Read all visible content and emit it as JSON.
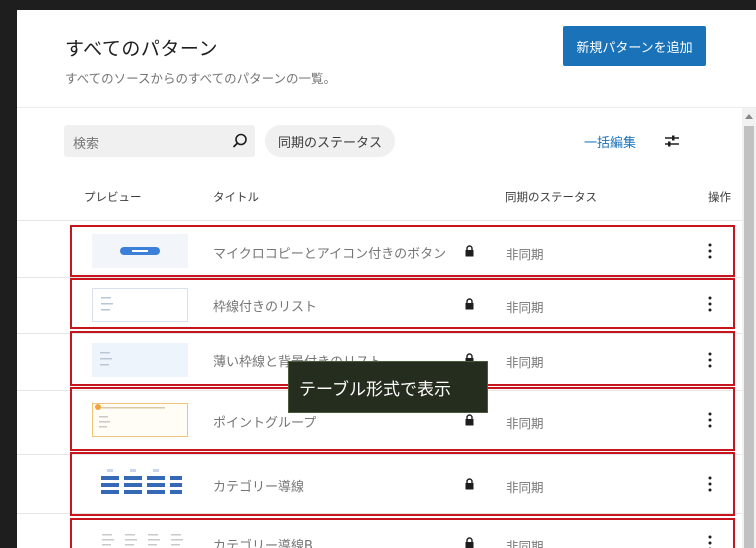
{
  "header": {
    "title": "すべてのパターン",
    "subtitle": "すべてのソースからのすべてのパターンの一覧。",
    "add_button": "新規パターンを追加"
  },
  "toolbar": {
    "search_placeholder": "検索",
    "sync_filter": "同期のステータス",
    "bulk_edit": "一括編集",
    "icons": {
      "search": "search-icon",
      "filter": "sliders-icon"
    }
  },
  "table": {
    "columns": {
      "preview": "プレビュー",
      "title": "タイトル",
      "status": "同期のステータス",
      "actions": "操作"
    },
    "rows": [
      {
        "title": "マイクロコピーとアイコン付きのボタン",
        "status": "非同期",
        "locked": true,
        "preview": "button"
      },
      {
        "title": "枠線付きのリスト",
        "status": "非同期",
        "locked": true,
        "preview": "bordered-list"
      },
      {
        "title": "薄い枠線と背景付きのリスト",
        "status": "非同期",
        "locked": true,
        "preview": "light-list"
      },
      {
        "title": "ポイントグループ",
        "status": "非同期",
        "locked": true,
        "preview": "point-group"
      },
      {
        "title": "カテゴリー導線",
        "status": "非同期",
        "locked": true,
        "preview": "category-grid"
      },
      {
        "title": "カテゴリー導線B",
        "status": "非同期",
        "locked": true,
        "preview": "category-list"
      }
    ]
  },
  "tooltip": {
    "text": "テーブル形式で表示"
  },
  "colors": {
    "accent": "#1a72b9",
    "highlight_border": "#c8151d",
    "tooltip_bg": "#252d1e"
  }
}
